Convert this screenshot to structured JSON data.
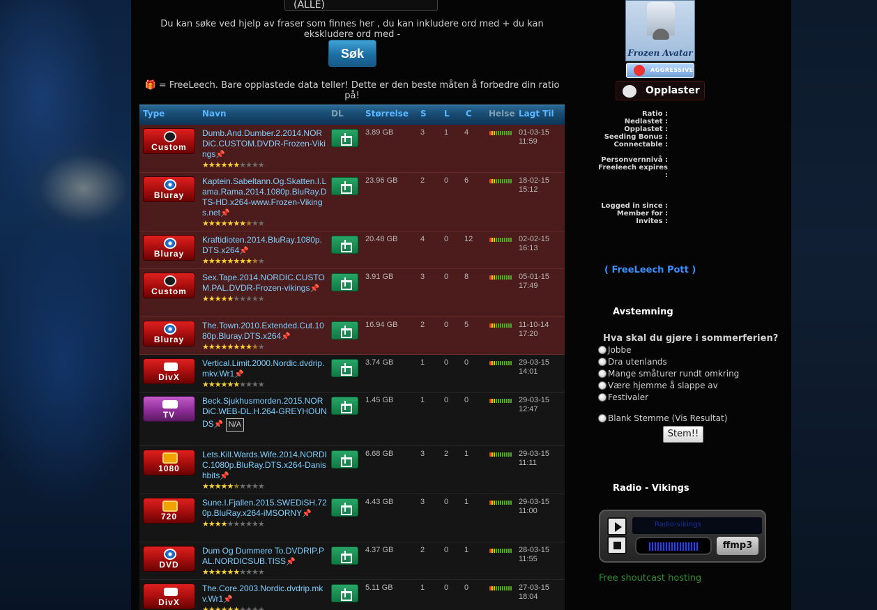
{
  "search": {
    "category_value": "(ALLE)",
    "help_text": "Du kan søke ved hjelp av fraser som finnes her , du kan inkludere ord med + du kan ekskludere ord med -",
    "button_label": "Søk",
    "freeleech_note": "🎁 = FreeLeech. Bare opplastede data teller! Dette er den beste måten å forbedre din ratio på!"
  },
  "table": {
    "headers": {
      "type": "Type",
      "name": "Navn",
      "dl": "DL",
      "size": "Størrelse",
      "seeders": "S",
      "leechers": "L",
      "completed": "C",
      "health": "Helse",
      "added": "Lagt Til"
    },
    "rows": [
      {
        "type": "Custom",
        "icon": "custom-skull",
        "name": "Dumb.And.Dumber.2.2014.NORDiC.CUSTOM.DVDR-Frozen-Vikings",
        "rating": 6,
        "size": "3.89 GB",
        "s": "3",
        "l": "1",
        "c": "4",
        "date": "01-03-15",
        "time": "11:59",
        "freeleech": true
      },
      {
        "type": "Bluray",
        "icon": "bluray-disc",
        "name": "Kaptein.Sabeltann.Og.Skatten.I.Lama.Rama.2014.1080p.BluRay.DTS-HD.x264-www.Frozen-Vikings.net",
        "rating": 7.5,
        "size": "23.96 GB",
        "s": "2",
        "l": "0",
        "c": "6",
        "date": "18-02-15",
        "time": "15:12",
        "freeleech": true
      },
      {
        "type": "Bluray",
        "icon": "bluray-disc",
        "name": "Kraftidioten.2014.BluRay.1080p.DTS.x264",
        "rating": 8.5,
        "size": "20.48 GB",
        "s": "4",
        "l": "0",
        "c": "12",
        "date": "02-02-15",
        "time": "16:13",
        "freeleech": true
      },
      {
        "type": "Custom",
        "icon": "custom-skull",
        "name": "Sex.Tape.2014.NORDIC.CUSTOM.PAL.DVDR-Frozen-vikings",
        "rating": 5,
        "size": "3.91 GB",
        "s": "3",
        "l": "0",
        "c": "8",
        "date": "05-01-15",
        "time": "17:49",
        "freeleech": true
      },
      {
        "type": "Bluray",
        "icon": "bluray-disc",
        "name": "The.Town.2010.Extended.Cut.1080p.Bluray.DTS.x264",
        "rating": 8.5,
        "size": "16.94 GB",
        "s": "2",
        "l": "0",
        "c": "5",
        "date": "11-10-14",
        "time": "17:20",
        "freeleech": true
      },
      {
        "type": "DivX",
        "icon": "camera",
        "name": "Vertical.Limit.2000.Nordic.dvdrip.mkv.Wr1",
        "rating": 6,
        "size": "3.74 GB",
        "s": "1",
        "l": "0",
        "c": "0",
        "date": "29-03-15",
        "time": "14:01",
        "freeleech": false
      },
      {
        "type": "TV",
        "icon": "tv-set",
        "name": "Beck.Sjukhusmorden.2015.NORDiC.WEB-DL.H.264-GREYHOUNDS",
        "rating": null,
        "rating_alt": "N/A",
        "size": "1.45 GB",
        "s": "1",
        "l": "0",
        "c": "0",
        "date": "29-03-15",
        "time": "12:47",
        "freeleech": false
      },
      {
        "type": "1080",
        "icon": "hd-badge",
        "name": "Lets.Kill.Wards.Wife.2014.NORDIC.1080p.BluRay.DTS.x264-Danishbits",
        "rating": 5.5,
        "size": "6.68 GB",
        "s": "3",
        "l": "2",
        "c": "1",
        "date": "29-03-15",
        "time": "11:11",
        "freeleech": false
      },
      {
        "type": "720",
        "icon": "hd-badge",
        "name": "Sune.I.Fjallen.2015.SWEDiSH.720p.BluRay.x264-iMSORNY",
        "rating": 4,
        "size": "4.43 GB",
        "s": "3",
        "l": "0",
        "c": "1",
        "date": "29-03-15",
        "time": "11:00",
        "freeleech": false
      },
      {
        "type": "DVD",
        "icon": "dvd-disc",
        "name": "Dum Og Dummere To.DVDRIP.PAL.NORDICSUB.TISS",
        "rating": 6,
        "size": "4.37 GB",
        "s": "2",
        "l": "0",
        "c": "1",
        "date": "28-03-15",
        "time": "11:55",
        "freeleech": false
      },
      {
        "type": "DivX",
        "icon": "camera",
        "name": "The.Core.2003.Nordic.dvdrip.mkv.Wr1",
        "rating": 6,
        "size": "5.11 GB",
        "s": "1",
        "l": "0",
        "c": "0",
        "date": "27-03-15",
        "time": "18:04",
        "freeleech": false
      }
    ]
  },
  "sidebar": {
    "avatar_caption": "Frozen Avatar",
    "mood_badge": "AGGRESSIVE",
    "rank": "Opplaster",
    "stats_labels": [
      "Ratio :",
      "Nedlastet :",
      "Opplastet :",
      "Seeding Bonus :",
      "Connectable :",
      "",
      "Personvernnivå :",
      "Freeleech expires :",
      "",
      "",
      "",
      "",
      "Logged in since :",
      "Member for :",
      "Invites :"
    ],
    "freeleech_pott": "( FreeLeech Pott )",
    "poll": {
      "title": "Avstemning",
      "question": "Hva skal du gjøre i sommerferien?",
      "options": [
        "Jobbe",
        "Dra utenlands",
        "Mange småturer rundt omkring",
        "Være hjemme å slappe av",
        "Festivaler"
      ],
      "blank": "Blank Stemme (Vis Resultat)",
      "vote_button": "Stem!!"
    },
    "radio": {
      "title": "Radio - Vikings",
      "station": "Radio-vikings",
      "logo": "ffmp3",
      "footer_link": "Free shoutcast hosting"
    }
  },
  "colors": {
    "link": "#7fd0ff",
    "freeleech_row": "#4c1b1b",
    "header_accent": "#5ab6ff",
    "download_green": "#1a9a58"
  }
}
